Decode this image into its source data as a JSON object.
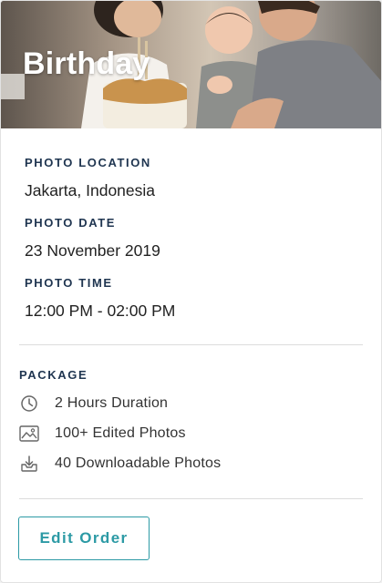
{
  "event": {
    "title": "Birthday"
  },
  "details": {
    "location_label": "PHOTO LOCATION",
    "location_value": "Jakarta, Indonesia",
    "date_label": "PHOTO DATE",
    "date_value": "23 November 2019",
    "time_label": "PHOTO TIME",
    "time_value": "12:00 PM - 02:00 PM"
  },
  "package": {
    "label": "PACKAGE",
    "items": [
      {
        "icon": "clock-icon",
        "text": "2 Hours Duration"
      },
      {
        "icon": "image-icon",
        "text": "100+ Edited Photos"
      },
      {
        "icon": "download-icon",
        "text": "40 Downloadable Photos"
      }
    ]
  },
  "actions": {
    "edit_order_label": "Edit Order"
  },
  "colors": {
    "accent": "#2c9aa5",
    "label": "#1f3550"
  }
}
